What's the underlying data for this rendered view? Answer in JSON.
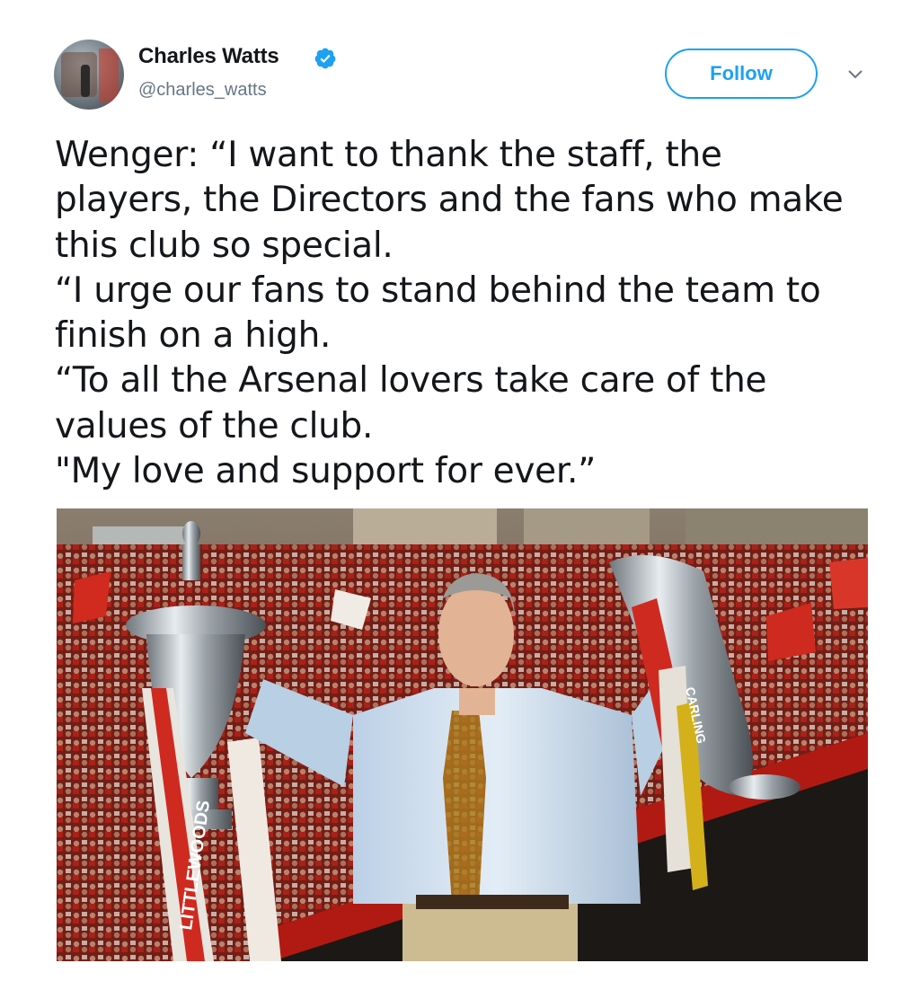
{
  "author": {
    "name": "Charles Watts",
    "handle": "@charles_watts",
    "verified": true,
    "verified_icon": "verified-badge-icon"
  },
  "follow_label": "Follow",
  "menu_icon": "chevron-down-icon",
  "tweet_lines": [
    "Wenger: “I want to thank the staff, the",
    "players, the Directors and the fans who make",
    "this club so special.",
    "“I urge our fans to stand behind the team to",
    "finish on a high.",
    "“To all the Arsenal lovers take care of the",
    "values of the club.",
    "\"My love and support for ever.”"
  ],
  "photo": {
    "ribbon_text_left": "LITTLEWOODS",
    "ribbon_text_right": "CARLING"
  },
  "colors": {
    "accent": "#1da1f2",
    "text": "#14171a",
    "muted": "#657786"
  }
}
